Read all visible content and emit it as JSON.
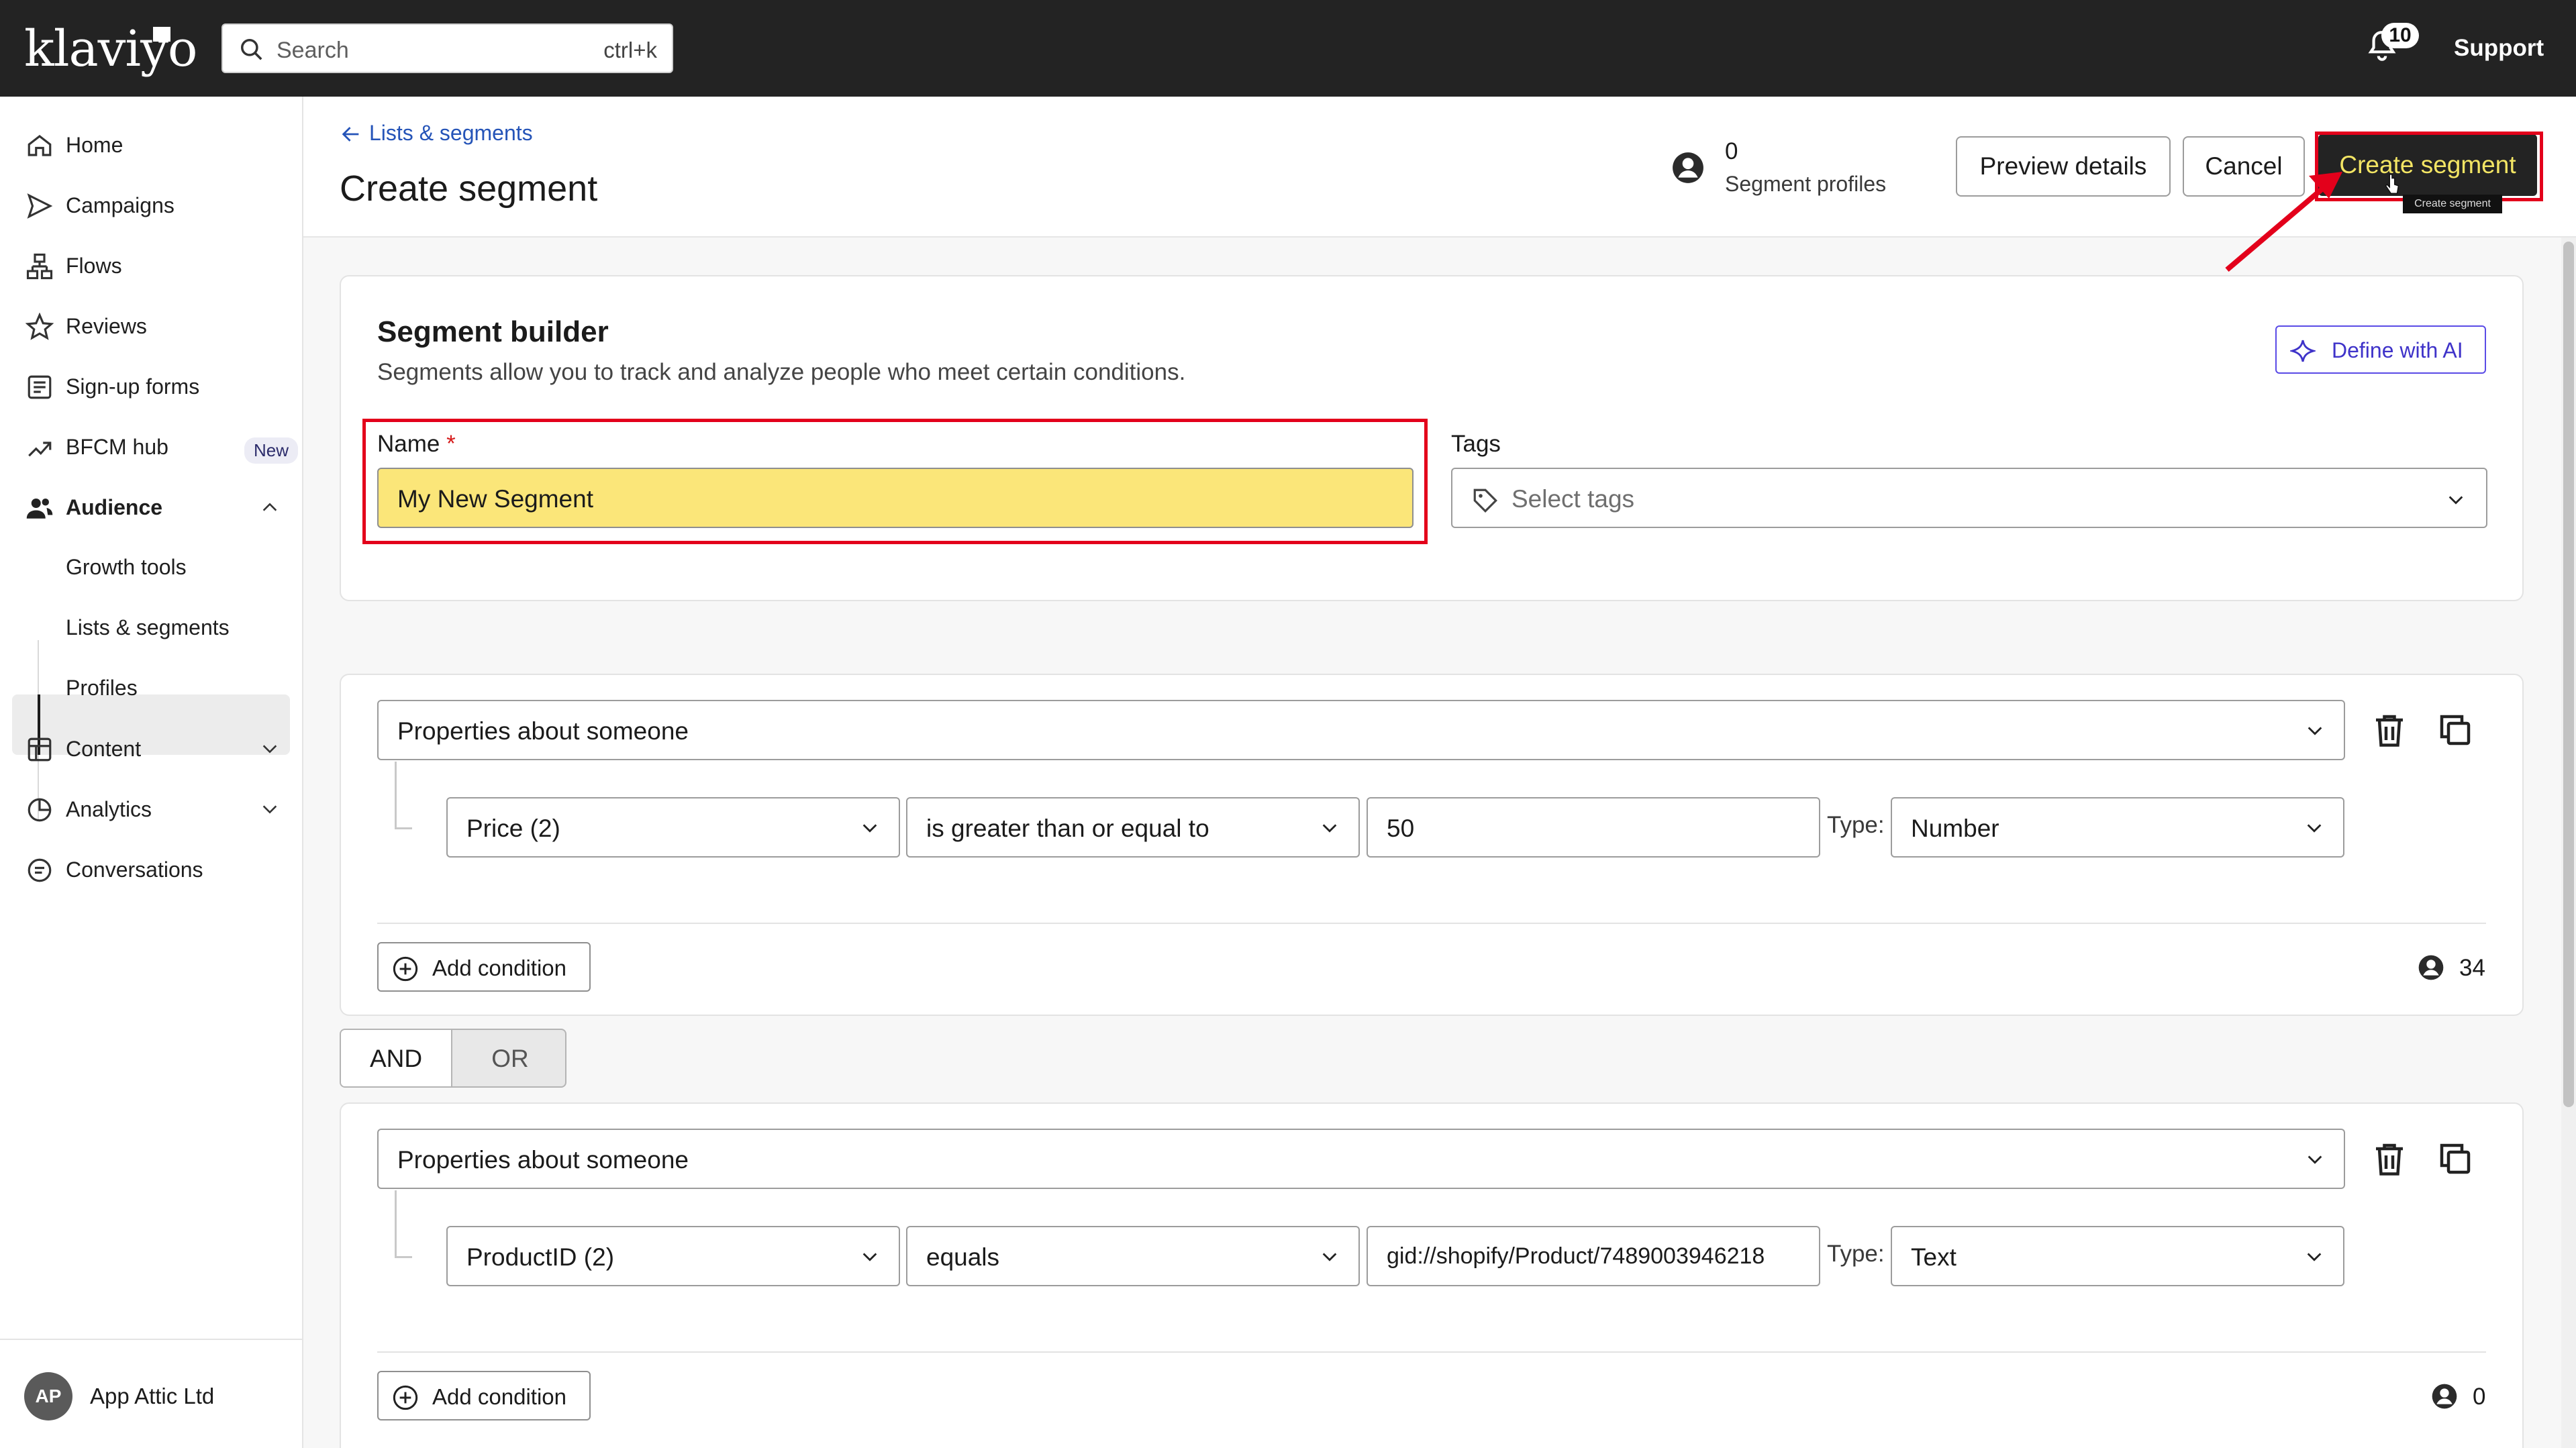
{
  "app": {
    "logo": "klaviyo"
  },
  "topbar": {
    "search_placeholder": "Search",
    "search_shortcut": "ctrl+k",
    "notification_count": "10",
    "support_label": "Support"
  },
  "sidebar": {
    "items": [
      {
        "label": "Home",
        "icon": "home-icon"
      },
      {
        "label": "Campaigns",
        "icon": "send-icon"
      },
      {
        "label": "Flows",
        "icon": "flows-icon"
      },
      {
        "label": "Reviews",
        "icon": "star-icon"
      },
      {
        "label": "Sign-up forms",
        "icon": "form-icon"
      },
      {
        "label": "BFCM hub",
        "icon": "trend-icon",
        "badge": "New"
      },
      {
        "label": "Audience",
        "icon": "people-icon"
      },
      {
        "label": "Content",
        "icon": "content-icon"
      },
      {
        "label": "Analytics",
        "icon": "analytics-icon"
      },
      {
        "label": "Conversations",
        "icon": "chat-icon"
      }
    ],
    "audience_sub": [
      "Growth tools",
      "Lists & segments",
      "Profiles"
    ],
    "account": {
      "initials": "AP",
      "name": "App Attic Ltd"
    }
  },
  "header": {
    "breadcrumb": "Lists & segments",
    "title": "Create segment",
    "profiles_count": "0",
    "profiles_label": "Segment profiles",
    "preview_label": "Preview details",
    "cancel_label": "Cancel",
    "create_label": "Create segment",
    "tooltip": "Create segment"
  },
  "builder": {
    "title": "Segment builder",
    "description": "Segments allow you to track and analyze people who meet certain conditions.",
    "ai_label": "Define with AI",
    "name_label": "Name",
    "name_required": "*",
    "name_value": "My New Segment",
    "tags_label": "Tags",
    "tags_placeholder": "Select tags"
  },
  "groups": [
    {
      "definition": "Properties about someone",
      "property": "Price (2)",
      "operator": "is greater than or equal to",
      "value": "50",
      "type_label": "Type:",
      "type": "Number",
      "add_label": "Add condition",
      "count": "34"
    },
    {
      "definition": "Properties about someone",
      "property": "ProductID (2)",
      "operator": "equals",
      "value": "gid://shopify/Product/7489003946218",
      "type_label": "Type:",
      "type": "Text",
      "add_label": "Add condition",
      "count": "0"
    }
  ],
  "logic": {
    "and_label": "AND",
    "or_label": "OR",
    "selected": "AND"
  },
  "colors": {
    "topbar": "#232323",
    "primary_button_text": "#f3e564",
    "name_highlight": "#fbe679",
    "annotation_red": "#e3001b",
    "link_blue": "#2554b8",
    "ai_purple": "#5a4be6"
  }
}
